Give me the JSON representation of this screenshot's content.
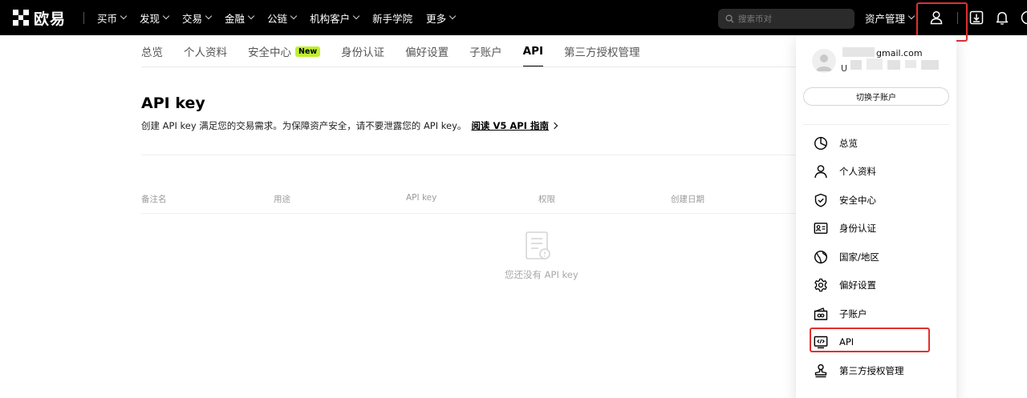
{
  "navbar": {
    "logo_text": "欧易",
    "menu": [
      {
        "label": "买币",
        "chevron": true
      },
      {
        "label": "发现",
        "chevron": true
      },
      {
        "label": "交易",
        "chevron": true
      },
      {
        "label": "金融",
        "chevron": true
      },
      {
        "label": "公链",
        "chevron": true
      },
      {
        "label": "机构客户",
        "chevron": true
      },
      {
        "label": "新手学院",
        "chevron": false
      },
      {
        "label": "更多",
        "chevron": true
      }
    ],
    "search_placeholder": "搜索币对",
    "assets_label": "资产管理",
    "icons": [
      "user-icon",
      "download-icon",
      "bell-icon"
    ]
  },
  "tabs": {
    "items": [
      {
        "label": "总览"
      },
      {
        "label": "个人资料"
      },
      {
        "label": "安全中心",
        "badge": "New"
      },
      {
        "label": "身份认证"
      },
      {
        "label": "偏好设置"
      },
      {
        "label": "子账户"
      },
      {
        "label": "API",
        "active": true
      },
      {
        "label": "第三方授权管理"
      }
    ]
  },
  "main": {
    "title": "API key",
    "description": "创建 API key 满足您的交易需求。为保障资产安全，请不要泄露您的 API key。",
    "guide_link": "阅读 V5 API 指南",
    "table_headers": [
      "备注名",
      "用途",
      "API key",
      "权限",
      "创建日期"
    ],
    "empty_text": "您还没有 API key"
  },
  "dropdown": {
    "email_suffix": "gmail.com",
    "uid_prefix": "U",
    "switch_label": "切换子账户",
    "items": [
      {
        "label": "总览",
        "icon": "pie-chart-icon"
      },
      {
        "label": "个人资料",
        "icon": "user-icon"
      },
      {
        "label": "安全中心",
        "icon": "shield-check-icon"
      },
      {
        "label": "身份认证",
        "icon": "id-card-icon"
      },
      {
        "label": "国家/地区",
        "icon": "globe-icon"
      },
      {
        "label": "偏好设置",
        "icon": "gear-icon"
      },
      {
        "label": "子账户",
        "icon": "wallet-icon"
      },
      {
        "label": "API",
        "icon": "code-screen-icon",
        "highlighted": true
      },
      {
        "label": "第三方授权管理",
        "icon": "stamp-icon"
      }
    ]
  },
  "colors": {
    "navbar_bg": "#000000",
    "badge_bg": "#bef02f",
    "highlight_border": "#e0302e"
  }
}
